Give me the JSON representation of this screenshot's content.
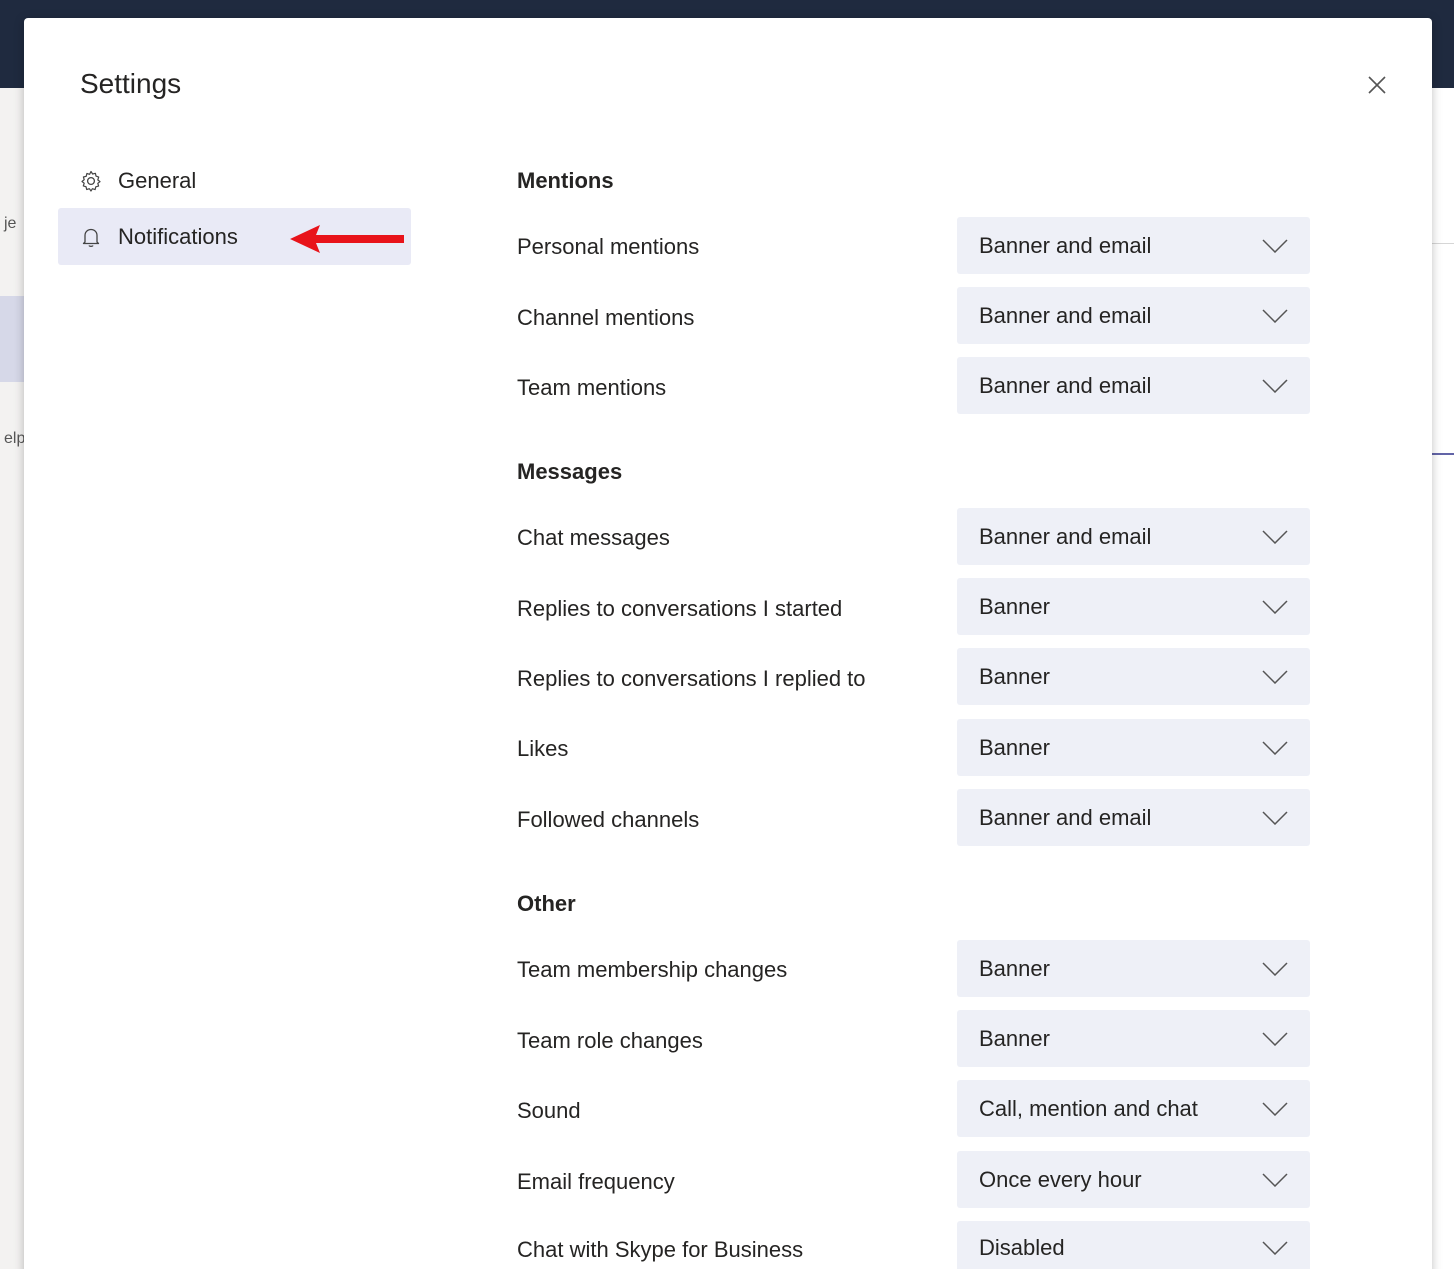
{
  "window": {
    "title": "Settings"
  },
  "background": {
    "fragment_1": "je",
    "fragment_2": "elp"
  },
  "nav": {
    "items": [
      {
        "label": "General",
        "icon": "gear-icon",
        "active": false
      },
      {
        "label": "Notifications",
        "icon": "bell-icon",
        "active": true
      }
    ]
  },
  "annotation": {
    "arrow_color": "#e8131a"
  },
  "sections": [
    {
      "title": "Mentions",
      "rows": [
        {
          "label": "Personal mentions",
          "value": "Banner and email"
        },
        {
          "label": "Channel mentions",
          "value": "Banner and email"
        },
        {
          "label": "Team mentions",
          "value": "Banner and email"
        }
      ]
    },
    {
      "title": "Messages",
      "rows": [
        {
          "label": "Chat messages",
          "value": "Banner and email"
        },
        {
          "label": "Replies to conversations I started",
          "value": "Banner"
        },
        {
          "label": "Replies to conversations I replied to",
          "value": "Banner"
        },
        {
          "label": "Likes",
          "value": "Banner"
        },
        {
          "label": "Followed channels",
          "value": "Banner and email"
        }
      ]
    },
    {
      "title": "Other",
      "rows": [
        {
          "label": "Team membership changes",
          "value": "Banner"
        },
        {
          "label": "Team role changes",
          "value": "Banner"
        },
        {
          "label": "Sound",
          "value": "Call, mention and chat"
        },
        {
          "label": "Email frequency",
          "value": "Once every hour"
        },
        {
          "label": "Chat with Skype for Business",
          "value": "Disabled"
        }
      ]
    }
  ],
  "colors": {
    "topbar": "#1f2a3f",
    "nav_active": "#e9eaf6",
    "select_bg": "#eef0f7"
  }
}
